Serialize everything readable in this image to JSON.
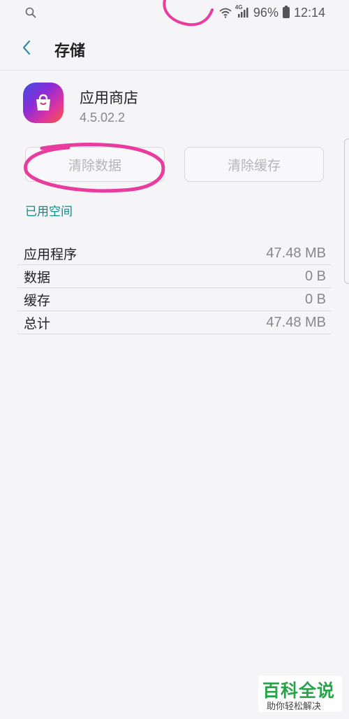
{
  "status_bar": {
    "signal_label": "4G",
    "battery": "96%",
    "time": "12:14"
  },
  "header": {
    "title": "存储"
  },
  "app": {
    "name": "应用商店",
    "version": "4.5.02.2"
  },
  "buttons": {
    "clear_data": "清除数据",
    "clear_cache": "清除缓存"
  },
  "section_title": "已用空间",
  "storage": [
    {
      "label": "应用程序",
      "value": "47.48 MB"
    },
    {
      "label": "数据",
      "value": "0 B"
    },
    {
      "label": "缓存",
      "value": "0 B"
    },
    {
      "label": "总计",
      "value": "47.48 MB"
    }
  ],
  "watermark": {
    "title": "百科全说",
    "subtitle": "助你轻松解决"
  },
  "colors": {
    "accent": "#0b8c88",
    "annotation": "#e8329a"
  }
}
